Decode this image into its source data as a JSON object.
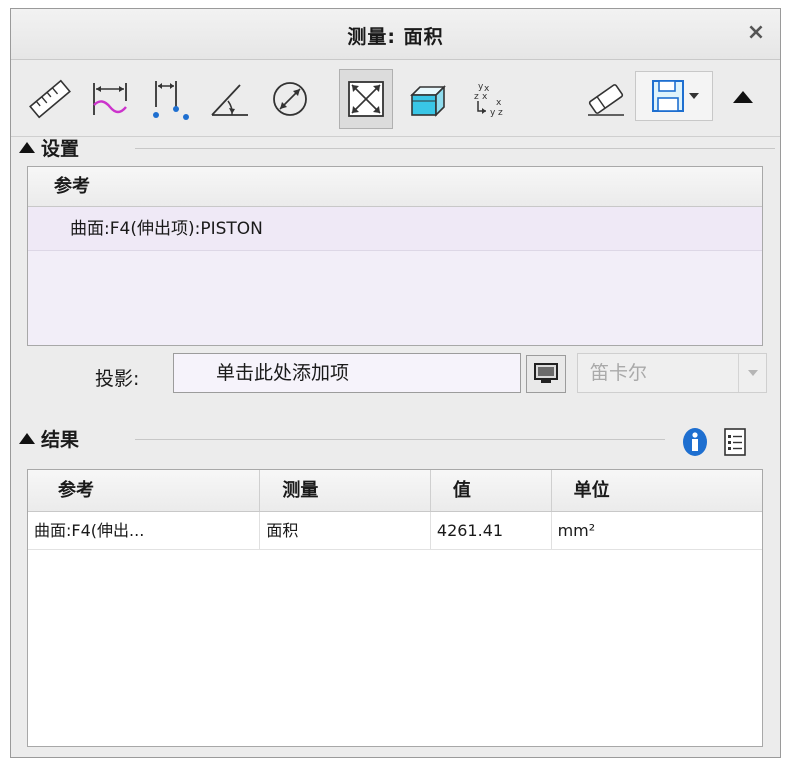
{
  "window": {
    "title": "测量: 面积",
    "close_glyph": "×"
  },
  "toolbar": {
    "tools": [
      {
        "name": "length-icon"
      },
      {
        "name": "distance-icon"
      },
      {
        "name": "span-icon"
      },
      {
        "name": "angle-icon"
      },
      {
        "name": "diameter-icon"
      },
      {
        "name": "area-icon",
        "active": true
      },
      {
        "name": "volume-icon"
      },
      {
        "name": "transform-icon"
      }
    ],
    "eraser": "eraser-icon",
    "save": "save-icon",
    "collapse": "collapse-triangle-icon"
  },
  "setup": {
    "section_label": "设置",
    "ref_header": "参考",
    "ref_items": [
      "曲面:F4(伸出项):PISTON"
    ],
    "projection_label": "投影:",
    "projection_placeholder": "单击此处添加项",
    "coord_system": "笛卡尔"
  },
  "results": {
    "section_label": "结果",
    "columns": [
      "参考",
      "测量",
      "值",
      "单位"
    ],
    "rows": [
      {
        "ref": "曲面:F4(伸出...",
        "measure": "面积",
        "value": "4261.41",
        "unit": "mm²"
      }
    ]
  },
  "colors": {
    "accent_blue": "#1e6fd0",
    "curve_magenta": "#cc33cc",
    "volume_cyan": "#39c6e6"
  }
}
